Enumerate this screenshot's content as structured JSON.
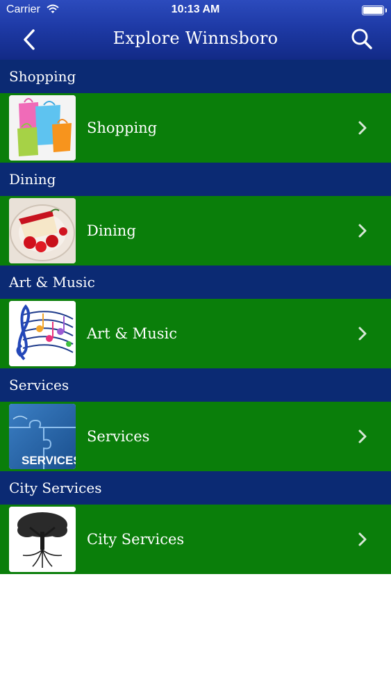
{
  "status_bar": {
    "carrier": "Carrier",
    "time": "10:13 AM"
  },
  "navbar": {
    "title": "Explore Winnsboro",
    "back_icon": "chevron-left-icon",
    "search_icon": "search-icon"
  },
  "colors": {
    "nav_blue": "#1e3aa6",
    "section_header": "#0b2a73",
    "row_green": "#0a7e0a",
    "text": "#ffffff"
  },
  "sections": [
    {
      "header": "Shopping",
      "row_label": "Shopping",
      "thumbnail": "shopping-bags-image"
    },
    {
      "header": "Dining",
      "row_label": "Dining",
      "thumbnail": "dessert-plate-image"
    },
    {
      "header": "Art & Music",
      "row_label": "Art & Music",
      "thumbnail": "music-notes-image"
    },
    {
      "header": "Services",
      "row_label": "Services",
      "thumbnail": "services-puzzle-image",
      "thumbnail_text": "SERVICES"
    },
    {
      "header": "City Services",
      "row_label": "City Services",
      "thumbnail": "tree-image"
    }
  ]
}
